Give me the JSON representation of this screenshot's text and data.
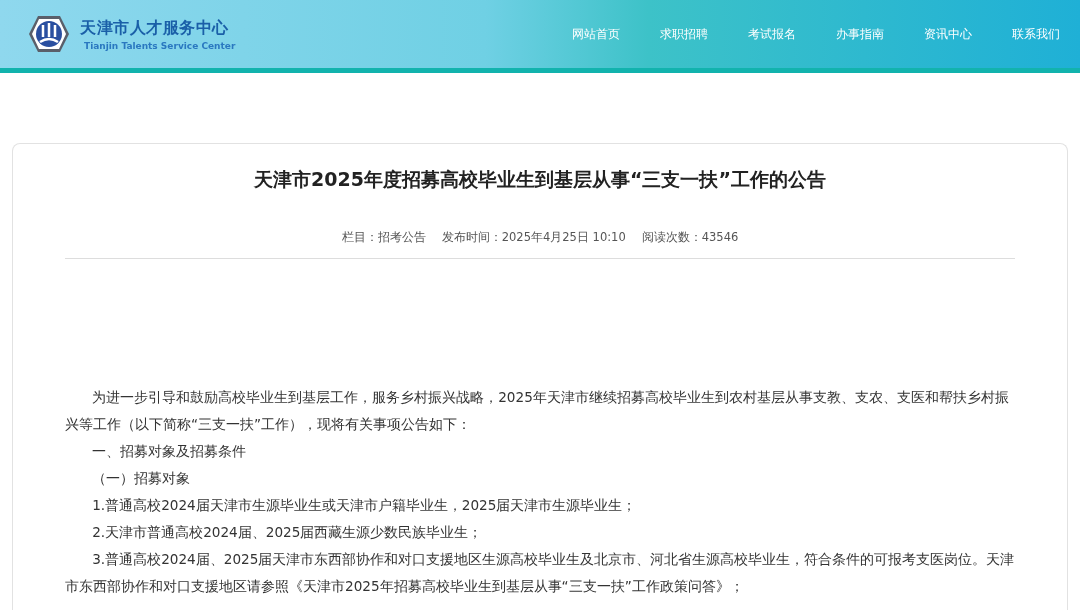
{
  "header": {
    "site_name": "天津市人才服务中心",
    "site_name_en": "Tianjin Talents Service Center"
  },
  "nav": [
    {
      "label": "网站首页"
    },
    {
      "label": "求职招聘"
    },
    {
      "label": "考试报名"
    },
    {
      "label": "办事指南"
    },
    {
      "label": "资讯中心"
    },
    {
      "label": "联系我们"
    }
  ],
  "article": {
    "title": "天津市2025年度招募高校毕业生到基层从事“三支一扶”工作的公告",
    "meta": [
      "栏目：招考公告",
      "发布时间：2025年4月25日 10:10",
      "阅读次数：43546"
    ],
    "paragraphs": [
      "为进一步引导和鼓励高校毕业生到基层工作，服务乡村振兴战略，2025年天津市继续招募高校毕业生到农村基层从事支教、支农、支医和帮扶乡村振兴等工作（以下简称“三支一扶”工作），现将有关事项公告如下：",
      "一、招募对象及招募条件",
      "（一）招募对象",
      "1.普通高校2024届天津市生源毕业生或天津市户籍毕业生，2025届天津市生源毕业生；",
      "2.天津市普通高校2024届、2025届西藏生源少数民族毕业生；",
      "3.普通高校2024届、2025届天津市东西部协作和对口支援地区生源高校毕业生及北京市、河北省生源高校毕业生，符合条件的可报考支医岗位。天津市东西部协作和对口支援地区请参照《天津市2025年招募高校毕业生到基层从事“三支一扶”工作政策问答》；"
    ]
  }
}
